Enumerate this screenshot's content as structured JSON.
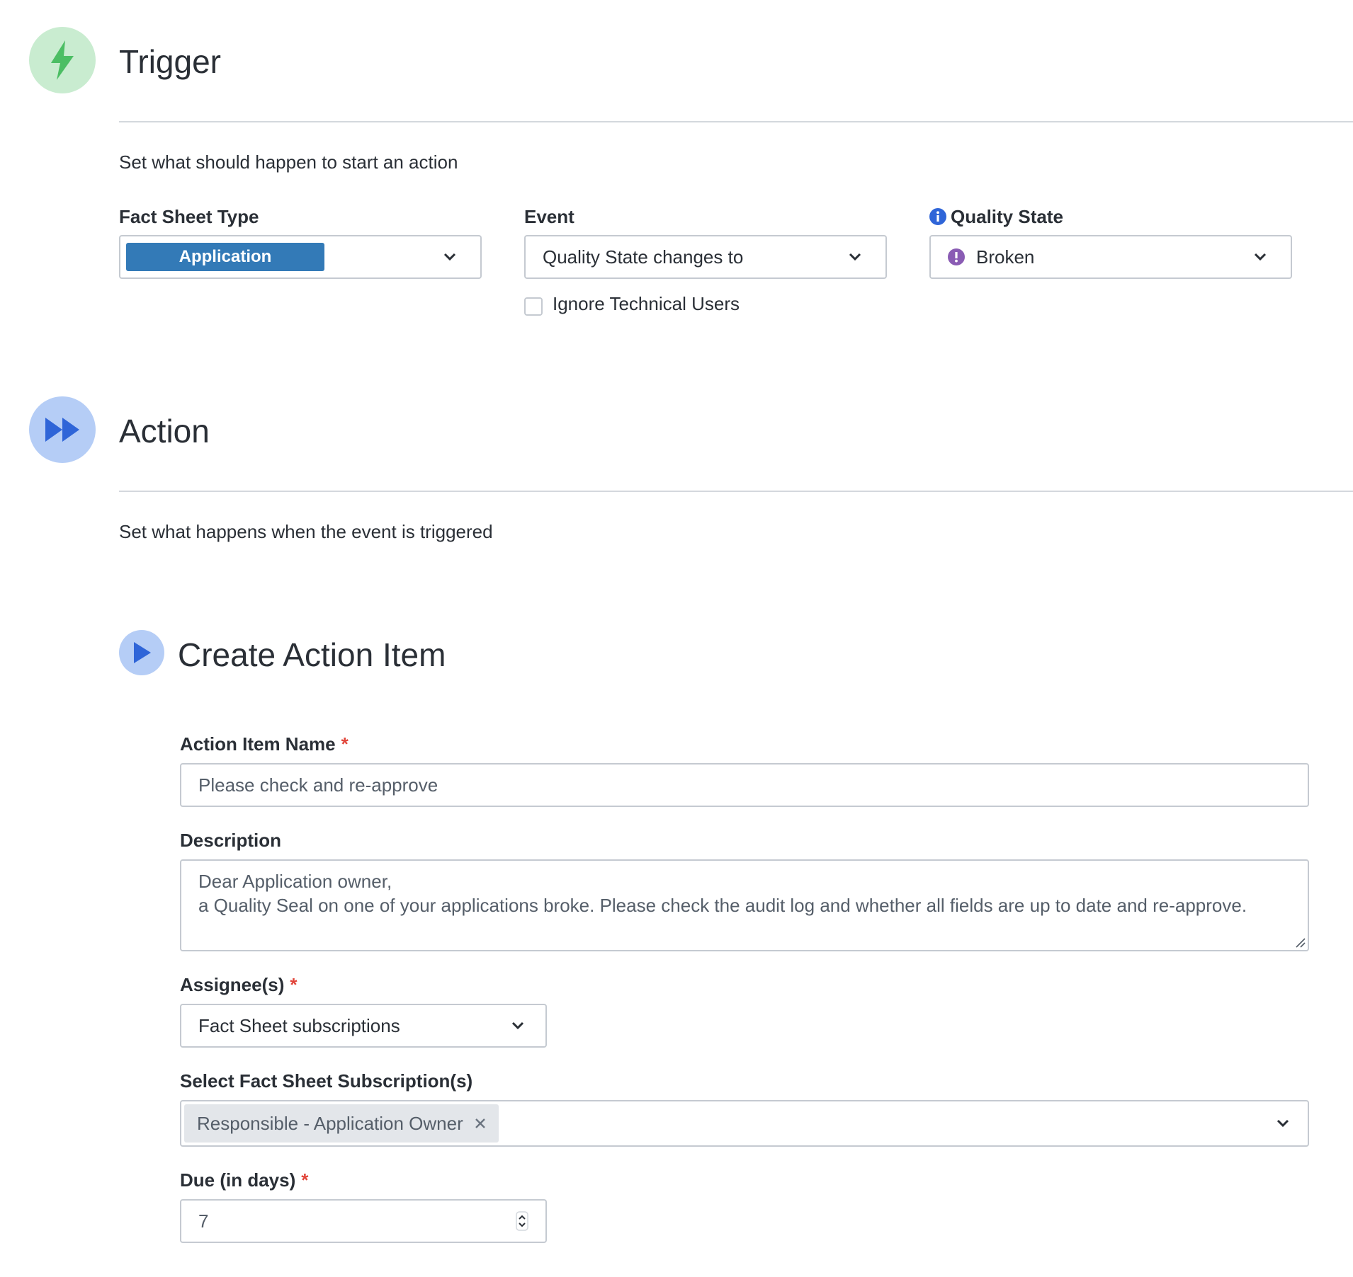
{
  "trigger": {
    "title": "Trigger",
    "icon": "lightning-bolt-icon",
    "description": "Set what should happen to start an action",
    "fact_sheet_type": {
      "label": "Fact Sheet Type",
      "value": "Application"
    },
    "event": {
      "label": "Event",
      "value": "Quality State changes to"
    },
    "ignore_technical_users": {
      "label": "Ignore Technical Users",
      "checked": false
    },
    "quality_state": {
      "label": "Quality State",
      "info_icon": "info-icon",
      "value": "Broken",
      "value_icon": "exclamation-circle-icon"
    }
  },
  "action": {
    "title": "Action",
    "icon": "fast-forward-icon",
    "description": "Set what happens when the event is triggered"
  },
  "create_action_item": {
    "title": "Create Action Item",
    "icon": "play-icon",
    "name": {
      "label": "Action Item Name",
      "required_mark": "*",
      "value": "Please check and re-approve"
    },
    "description": {
      "label": "Description",
      "value_line1": "Dear Application owner,",
      "value_line2": "a Quality Seal on one of your applications broke. Please check the audit log and whether all fields are up to date and re-approve."
    },
    "assignees": {
      "label": "Assignee(s)",
      "required_mark": "*",
      "value": "Fact Sheet subscriptions"
    },
    "subscriptions": {
      "label": "Select Fact Sheet Subscription(s)",
      "selected": [
        "Responsible - Application Owner"
      ]
    },
    "due": {
      "label": "Due (in days)",
      "required_mark": "*",
      "value": "7"
    }
  },
  "colors": {
    "trigger_icon_bg": "#c9ecd0",
    "trigger_icon_fg": "#4cbe64",
    "action_icon_bg": "#b5cdf6",
    "action_icon_fg": "#2f65d8",
    "pill_bg": "#337ab7",
    "required": "#e1453a",
    "quality_icon": "#8a5cb4"
  }
}
